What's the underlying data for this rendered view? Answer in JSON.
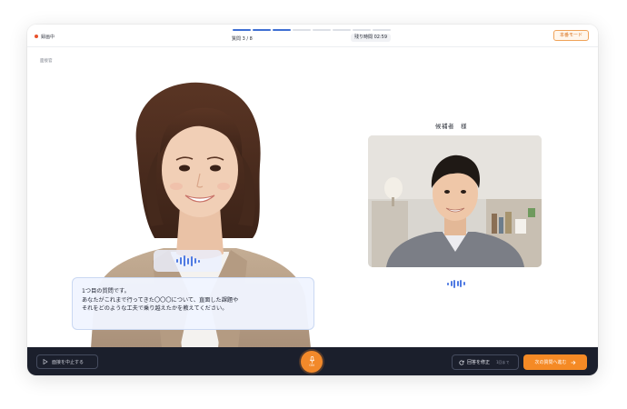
{
  "header": {
    "recording_status": "録画中",
    "progress": {
      "current": 3,
      "total": 8
    },
    "question_count": "質問 3 / 8",
    "time_remaining": "残り時間 02:59",
    "mode_button": "本番モード"
  },
  "interviewer": {
    "role_label": "面接官",
    "speech_lines": [
      "1つ目の質問です。",
      "あなたがこれまで行ってきた〇〇〇について、直面した課題や",
      "それをどのような工夫で乗り越えたかを教えてください。"
    ]
  },
  "candidate": {
    "name": "候補者　様"
  },
  "footer": {
    "stop_button": "面接を中止する",
    "mic_label": "ON",
    "retry_button": "回答を修正",
    "retry_count": "1回まで",
    "next_button": "次の質問へ進む"
  },
  "colors": {
    "accent_orange": "#f58a25",
    "accent_blue": "#3f6fd3",
    "recording_red": "#e8522c",
    "footer_dark": "#1b1f2c"
  },
  "icons": {
    "recording": "recording-dot-icon",
    "stop": "stop-icon",
    "mic": "microphone-icon",
    "retry": "refresh-icon",
    "next": "arrow-right-icon",
    "audio": "audio-waveform-icon"
  }
}
